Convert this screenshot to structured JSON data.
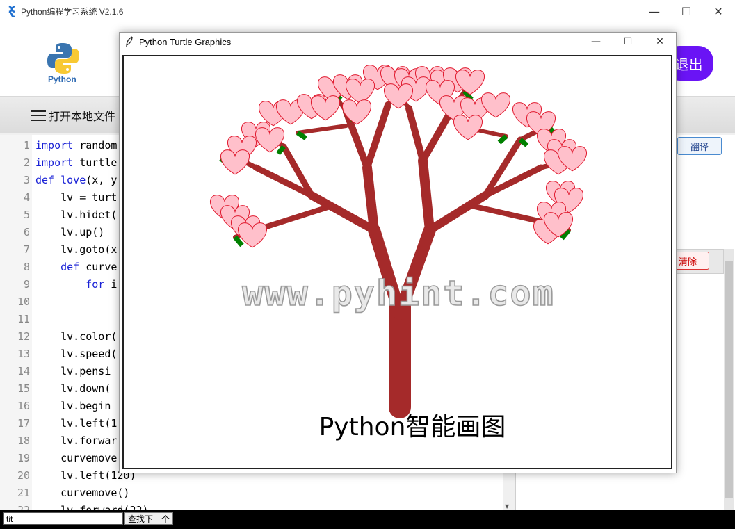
{
  "window": {
    "title": "Python编程学习系统 V2.1.6",
    "minimize": "—",
    "maximize": "☐",
    "close": "✕"
  },
  "header": {
    "logo_text": "Python",
    "exit_label": "退出"
  },
  "toolbar": {
    "open_file_label": "打开本地文件"
  },
  "editor": {
    "lines": [
      {
        "n": "1",
        "t": "import random"
      },
      {
        "n": "2",
        "t": "import turtle"
      },
      {
        "n": "3",
        "t": "def love(x, y"
      },
      {
        "n": "4",
        "t": "    lv = turt"
      },
      {
        "n": "5",
        "t": "    lv.hidet("
      },
      {
        "n": "6",
        "t": "    lv.up()"
      },
      {
        "n": "7",
        "t": "    lv.goto(x"
      },
      {
        "n": "8",
        "t": "    def curve"
      },
      {
        "n": "9",
        "t": "        for i"
      },
      {
        "n": "10",
        "t": ""
      },
      {
        "n": "11",
        "t": ""
      },
      {
        "n": "12",
        "t": "    lv.color("
      },
      {
        "n": "13",
        "t": "    lv.speed("
      },
      {
        "n": "14",
        "t": "    lv.pensi"
      },
      {
        "n": "15",
        "t": "    lv.down("
      },
      {
        "n": "16",
        "t": "    lv.begin_"
      },
      {
        "n": "17",
        "t": "    lv.left(1"
      },
      {
        "n": "18",
        "t": "    lv.forwar"
      },
      {
        "n": "19",
        "t": "    curvemove"
      },
      {
        "n": "20",
        "t": "    lv.left(120)"
      },
      {
        "n": "21",
        "t": "    curvemove()"
      },
      {
        "n": "22",
        "t": "    lv.forward(22)"
      }
    ]
  },
  "right_panel": {
    "translate_label": "翻译",
    "clear_label": "清除"
  },
  "find_bar": {
    "input_value": "tit",
    "find_next_label": "查找下一个"
  },
  "turtle_window": {
    "title": "Python Turtle Graphics",
    "watermark": "www.pyhint.com",
    "caption": "Python智能画图"
  },
  "colors": {
    "trunk": "#a52a2a",
    "leaf": "#008000",
    "heart_fill": "#ffc0cb",
    "heart_stroke": "#e0182d",
    "exit_button": "#6a14f5"
  }
}
